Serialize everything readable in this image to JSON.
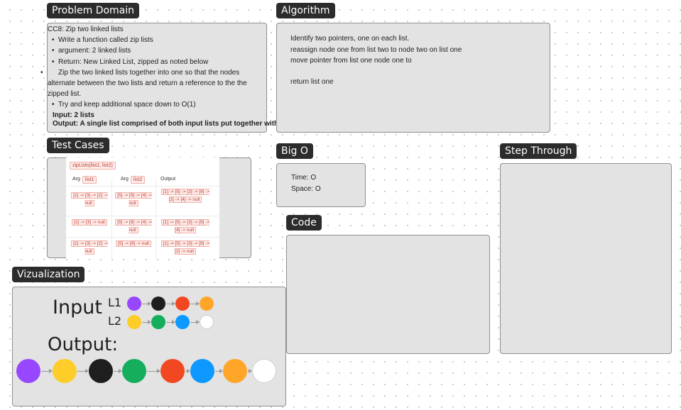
{
  "problem_domain": {
    "label": "Problem Domain",
    "heading": "CC8: Zip two linked lists",
    "bullets": [
      "Write a function called zip lists",
      "argument: 2 linked lists",
      "Return: New Linked List, zipped as noted below",
      "Zip the two linked lists together into one so that the nodes alternate between the two lists and return a reference to the the zipped list.",
      "Try and keep additional space down to O(1)"
    ],
    "input_line": "Input: 2 lists",
    "output_line": "Output: A single list comprised of both input lists put together with"
  },
  "algorithm": {
    "label": "Algorithm",
    "lines": [
      "Identify two pointers, one on each list.",
      "reassign node one from list two to node two on list one",
      "move pointer from list one node one to",
      "return list one"
    ]
  },
  "test_cases": {
    "label": "Test Cases",
    "signature": "zipLists(list1, list2)",
    "headers": [
      "Arg",
      "list1",
      "Arg",
      "list2",
      "Output"
    ],
    "rows": [
      [
        "[1] -> [3] -> [2] -> null",
        "[5] -> [9] -> [4] -> null",
        "[1] -> [5] -> [3] -> [9] -> [2] -> [4] -> null"
      ],
      [
        "[1] -> [3] -> null",
        "[5] -> [9] -> [4] -> null",
        "[1] -> [5] -> [3] -> [9] -> [4] -> null"
      ],
      [
        "[1] -> [3] -> [2] -> null",
        "[5] -> [9] -> null",
        "[1] -> [5] -> [3] -> [9] -> [2] -> null"
      ]
    ]
  },
  "big_o": {
    "label": "Big O",
    "time": "Time: O",
    "space": "Space: O"
  },
  "step_through": {
    "label": "Step Through"
  },
  "code": {
    "label": "Code"
  },
  "visualization": {
    "label": "Vizualization",
    "input_label": "Input",
    "output_label": "Output:",
    "l1_label": "L1",
    "l2_label": "L2",
    "l1_colors": [
      "#9747ff",
      "#1e1e1e",
      "#f24822",
      "#ffa629"
    ],
    "l2_colors": [
      "#ffcd29",
      "#14ae5c",
      "#0d99ff",
      "#ffffff"
    ],
    "output_colors": [
      "#9747ff",
      "#ffcd29",
      "#1e1e1e",
      "#14ae5c",
      "#f24822",
      "#0d99ff",
      "#ffa629",
      "#ffffff"
    ]
  }
}
